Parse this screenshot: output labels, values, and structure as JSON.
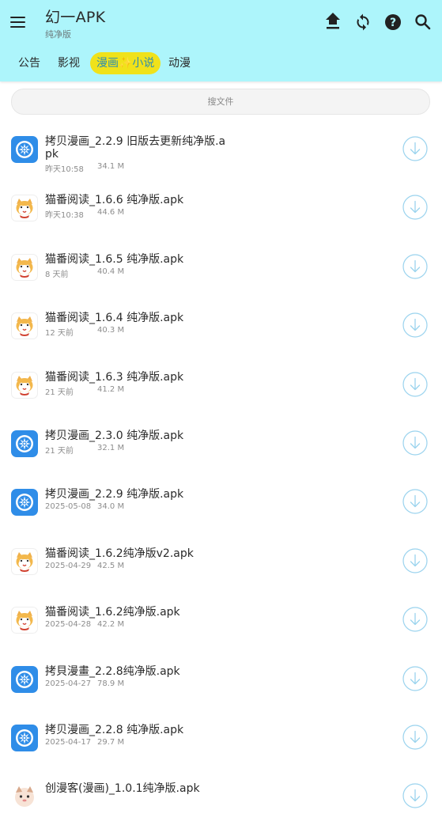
{
  "header": {
    "title": "幻一APK",
    "subtitle": "纯净版",
    "bg_color": "#adf5fb",
    "icons": [
      "menu-icon",
      "upload-icon",
      "refresh-icon",
      "help-icon",
      "search-icon"
    ]
  },
  "tabs": [
    {
      "label": "公告",
      "active": false
    },
    {
      "label": "影视",
      "active": false
    },
    {
      "label": "漫画✨小说",
      "active": true
    },
    {
      "label": "动漫",
      "active": false
    }
  ],
  "search": {
    "placeholder": "搜文件"
  },
  "accent": {
    "tab_active_bg": "#f0e21a",
    "tab_active_text": "#2f8fb0",
    "download_icon": "#9ad3ee"
  },
  "files": [
    {
      "name": "拷贝漫画_2.2.9 旧版去更新纯净版.apk",
      "date": "昨天10:58",
      "size": "34.1 M",
      "icon": "copymanga-icon"
    },
    {
      "name": "猫番阅读_1.6.6 纯净版.apk",
      "date": "昨天10:38",
      "size": "44.6 M",
      "icon": "maofan-cat-icon"
    },
    {
      "name": "猫番阅读_1.6.5 纯净版.apk",
      "date": "8 天前",
      "size": "40.4 M",
      "icon": "maofan-cat-icon"
    },
    {
      "name": "猫番阅读_1.6.4 纯净版.apk",
      "date": "12 天前",
      "size": "40.3 M",
      "icon": "maofan-cat-icon"
    },
    {
      "name": "猫番阅读_1.6.3 纯净版.apk",
      "date": "21 天前",
      "size": "41.2 M",
      "icon": "maofan-cat-icon"
    },
    {
      "name": "拷贝漫画_2.3.0 纯净版.apk",
      "date": "21 天前",
      "size": "32.1 M",
      "icon": "copymanga-icon"
    },
    {
      "name": "拷贝漫画_2.2.9 纯净版.apk",
      "date": "2025-05-08",
      "size": "34.0 M",
      "icon": "copymanga-icon"
    },
    {
      "name": "猫番阅读_1.6.2纯净版v2.apk",
      "date": "2025-04-29",
      "size": "42.5 M",
      "icon": "maofan-cat-icon"
    },
    {
      "name": "猫番阅读_1.6.2纯净版.apk",
      "date": "2025-04-28",
      "size": "42.2 M",
      "icon": "maofan-cat-icon"
    },
    {
      "name": "拷貝漫畫_2.2.8纯净版.apk",
      "date": "2025-04-27",
      "size": "78.9 M",
      "icon": "copymanga-icon"
    },
    {
      "name": "拷贝漫画_2.2.8 纯净版.apk",
      "date": "2025-04-17",
      "size": "29.7 M",
      "icon": "copymanga-icon"
    },
    {
      "name": "创漫客(漫画)_1.0.1纯净版.apk",
      "date": "",
      "size": "",
      "icon": "chuangmanke-icon"
    }
  ]
}
